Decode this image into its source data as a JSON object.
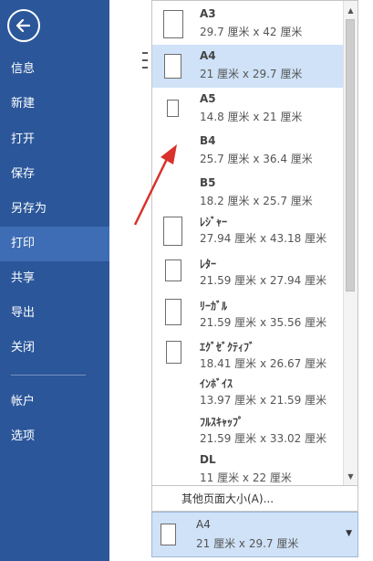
{
  "sidebar": {
    "items": [
      {
        "label": "信息"
      },
      {
        "label": "新建"
      },
      {
        "label": "打开"
      },
      {
        "label": "保存"
      },
      {
        "label": "另存为"
      },
      {
        "label": "打印",
        "active": true
      },
      {
        "label": "共享"
      },
      {
        "label": "导出"
      },
      {
        "label": "关闭"
      },
      {
        "label": "帐户"
      },
      {
        "label": "选项"
      }
    ]
  },
  "paper_sizes": [
    {
      "name": "A3",
      "dims": "29.7 厘米 x 42 厘米"
    },
    {
      "name": "A4",
      "dims": "21 厘米 x 29.7 厘米",
      "selected": true
    },
    {
      "name": "A5",
      "dims": "14.8 厘米 x 21 厘米"
    },
    {
      "name": "B4",
      "dims": "25.7 厘米 x 36.4 厘米"
    },
    {
      "name": "B5",
      "dims": "18.2 厘米 x 25.7 厘米"
    },
    {
      "name": "ﾚｼﾞｬｰ",
      "dims": "27.94 厘米 x 43.18 厘米"
    },
    {
      "name": "ﾚﾀｰ",
      "dims": "21.59 厘米 x 27.94 厘米"
    },
    {
      "name": "ﾘｰｶﾞﾙ",
      "dims": "21.59 厘米 x 35.56 厘米"
    },
    {
      "name": "ｴｸﾞｾﾞｸﾃｨﾌﾞ",
      "dims": "18.41 厘米 x 26.67 厘米"
    },
    {
      "name": "ｲﾝﾎﾞｲｽ",
      "dims": "13.97 厘米 x 21.59 厘米"
    },
    {
      "name": "ﾌﾙｽｷｬｯﾌﾟ",
      "dims": "21.59 厘米 x 33.02 厘米"
    },
    {
      "name": "DL",
      "dims": "11 厘米 x 22 厘米"
    }
  ],
  "more_sizes_label": "其他页面大小(A)...",
  "current_size": {
    "name": "A4",
    "dims": "21 厘米 x 29.7 厘米"
  },
  "colors": {
    "sidebar": "#2b579a",
    "sidebar_active": "#3e6db5",
    "selected": "#cfe2f7",
    "arrow": "#d9312b"
  }
}
